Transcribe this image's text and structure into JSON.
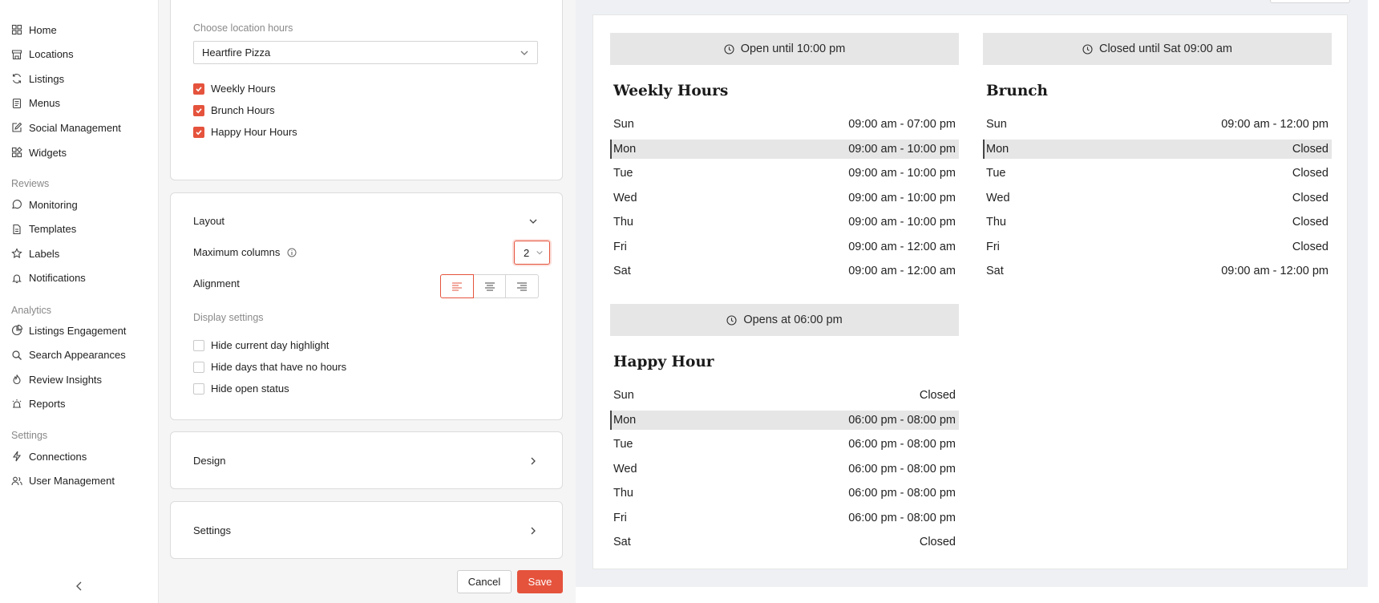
{
  "sidebar": {
    "nav_main": [
      {
        "label": "Home",
        "icon": "grid-icon"
      },
      {
        "label": "Locations",
        "icon": "store-icon"
      },
      {
        "label": "Listings",
        "icon": "sync-icon"
      },
      {
        "label": "Menus",
        "icon": "menu-doc-icon"
      },
      {
        "label": "Social Management",
        "icon": "edit-icon"
      },
      {
        "label": "Widgets",
        "icon": "widgets-icon"
      }
    ],
    "reviews_heading": "Reviews",
    "nav_reviews": [
      {
        "label": "Monitoring",
        "icon": "chat-icon"
      },
      {
        "label": "Templates",
        "icon": "document-icon"
      },
      {
        "label": "Labels",
        "icon": "star-icon"
      },
      {
        "label": "Notifications",
        "icon": "bell-icon"
      }
    ],
    "analytics_heading": "Analytics",
    "nav_analytics": [
      {
        "label": "Listings Engagement",
        "icon": "pie-icon"
      },
      {
        "label": "Search Appearances",
        "icon": "search-icon"
      },
      {
        "label": "Review Insights",
        "icon": "flame-icon"
      },
      {
        "label": "Reports",
        "icon": "alarm-icon"
      }
    ],
    "settings_heading": "Settings",
    "nav_settings": [
      {
        "label": "Connections",
        "icon": "bolt-icon"
      },
      {
        "label": "User Management",
        "icon": "users-icon"
      }
    ]
  },
  "editor": {
    "location_label": "Choose location hours",
    "location_value": "Heartfire Pizza",
    "hour_types": [
      {
        "label": "Weekly Hours",
        "checked": true
      },
      {
        "label": "Brunch Hours",
        "checked": true
      },
      {
        "label": "Happy Hour Hours",
        "checked": true
      }
    ],
    "layout": {
      "title": "Layout",
      "max_columns_label": "Maximum columns",
      "max_columns_value": "2",
      "alignment_label": "Alignment",
      "alignment_selected": "left",
      "display_settings_label": "Display settings",
      "display_options": [
        {
          "label": "Hide current day highlight",
          "checked": false
        },
        {
          "label": "Hide days that have no hours",
          "checked": false
        },
        {
          "label": "Hide open status",
          "checked": false
        }
      ]
    },
    "design_title": "Design",
    "settings_title": "Settings",
    "cancel_label": "Cancel",
    "save_label": "Save"
  },
  "preview": {
    "current_day": "Mon",
    "sections": [
      {
        "status": "Open until 10:00 pm",
        "title": "Weekly Hours",
        "rows": [
          {
            "day": "Sun",
            "hours": "09:00 am - 07:00 pm"
          },
          {
            "day": "Mon",
            "hours": "09:00 am - 10:00 pm"
          },
          {
            "day": "Tue",
            "hours": "09:00 am - 10:00 pm"
          },
          {
            "day": "Wed",
            "hours": "09:00 am - 10:00 pm"
          },
          {
            "day": "Thu",
            "hours": "09:00 am - 10:00 pm"
          },
          {
            "day": "Fri",
            "hours": "09:00 am - 12:00 am"
          },
          {
            "day": "Sat",
            "hours": "09:00 am - 12:00 am"
          }
        ]
      },
      {
        "status": "Closed until Sat 09:00 am",
        "title": "Brunch",
        "rows": [
          {
            "day": "Sun",
            "hours": "09:00 am - 12:00 pm"
          },
          {
            "day": "Mon",
            "hours": "Closed"
          },
          {
            "day": "Tue",
            "hours": "Closed"
          },
          {
            "day": "Wed",
            "hours": "Closed"
          },
          {
            "day": "Thu",
            "hours": "Closed"
          },
          {
            "day": "Fri",
            "hours": "Closed"
          },
          {
            "day": "Sat",
            "hours": "09:00 am - 12:00 pm"
          }
        ]
      },
      {
        "status": "Opens at 06:00 pm",
        "title": "Happy Hour",
        "rows": [
          {
            "day": "Sun",
            "hours": "Closed"
          },
          {
            "day": "Mon",
            "hours": "06:00 pm - 08:00 pm"
          },
          {
            "day": "Tue",
            "hours": "06:00 pm - 08:00 pm"
          },
          {
            "day": "Wed",
            "hours": "06:00 pm - 08:00 pm"
          },
          {
            "day": "Thu",
            "hours": "06:00 pm - 08:00 pm"
          },
          {
            "day": "Fri",
            "hours": "06:00 pm - 08:00 pm"
          },
          {
            "day": "Sat",
            "hours": "Closed"
          }
        ]
      }
    ]
  },
  "colors": {
    "accent": "#e5533d",
    "highlight": "#e6e6e6"
  }
}
